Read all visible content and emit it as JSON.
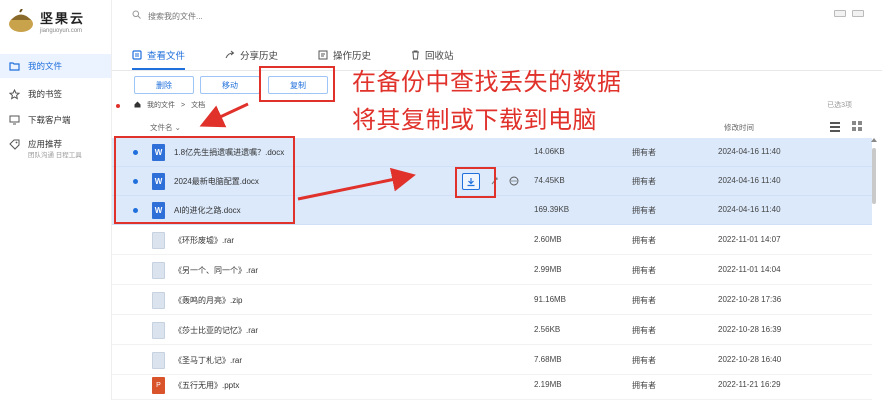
{
  "brand": {
    "name": "坚果云",
    "subtitle": "jianguoyun.com"
  },
  "sidebar": {
    "items": [
      {
        "label": "我的文件",
        "icon": "folder-icon",
        "active": true
      },
      {
        "label": "我的书签",
        "icon": "star-icon",
        "active": false
      },
      {
        "label": "下载客户端",
        "icon": "monitor-icon",
        "active": false
      },
      {
        "label": "应用推荐",
        "icon": "tag-icon",
        "active": false
      }
    ],
    "recommend_sub": "团队沟通 日程工具"
  },
  "search": {
    "placeholder": "搜索我的文件..."
  },
  "tabs": [
    {
      "label": "查看文件",
      "icon": "file-view-icon",
      "active": true
    },
    {
      "label": "分享历史",
      "icon": "share-icon",
      "active": false
    },
    {
      "label": "操作历史",
      "icon": "history-icon",
      "active": false
    },
    {
      "label": "回收站",
      "icon": "trash-icon",
      "active": false
    }
  ],
  "toolbar": {
    "delete_label": "删除",
    "move_label": "移动",
    "copy_label": "复制"
  },
  "breadcrumb": {
    "root": "我的文件",
    "sep": ">",
    "current": "文档"
  },
  "selected_info": "已选3项",
  "table": {
    "headers": {
      "name": "文件名",
      "size": "",
      "owner": "",
      "date": "修改时间"
    },
    "rows": [
      {
        "name": "1.8亿先生捐遗嘱进遗嘱？.docx",
        "size": "14.06KB",
        "owner": "拥有者",
        "date": "2024-04-16 11:40",
        "type": "word",
        "selected": true
      },
      {
        "name": "2024最新电脑配置.docx",
        "size": "74.45KB",
        "owner": "拥有者",
        "date": "2024-04-16 11:40",
        "type": "word",
        "selected": true
      },
      {
        "name": "AI的进化之路.docx",
        "size": "169.39KB",
        "owner": "拥有者",
        "date": "2024-04-16 11:40",
        "type": "word",
        "selected": true
      },
      {
        "name": "《环形废墟》.rar",
        "size": "2.60MB",
        "owner": "拥有者",
        "date": "2022-11-01 14:07",
        "type": "rar",
        "selected": false
      },
      {
        "name": "《另一个、同一个》.rar",
        "size": "2.99MB",
        "owner": "拥有者",
        "date": "2022-11-01 14:04",
        "type": "rar",
        "selected": false
      },
      {
        "name": "《轰鸣的月亮》.zip",
        "size": "91.16MB",
        "owner": "拥有者",
        "date": "2022-10-28 17:36",
        "type": "zip",
        "selected": false
      },
      {
        "name": "《莎士比亚的记忆》.rar",
        "size": "2.56KB",
        "owner": "拥有者",
        "date": "2022-10-28 16:39",
        "type": "rar",
        "selected": false
      },
      {
        "name": "《圣马丁札记》.rar",
        "size": "7.68MB",
        "owner": "拥有者",
        "date": "2022-10-28 16:40",
        "type": "rar",
        "selected": false
      },
      {
        "name": "《五行无用》.pptx",
        "size": "2.19MB",
        "owner": "拥有者",
        "date": "2022-11-21 16:29",
        "type": "ppt",
        "selected": false
      }
    ]
  },
  "annotation": {
    "line1": "在备份中查找丢失的数据",
    "line2": "将其复制或下载到电脑",
    "color": "#e0312b"
  },
  "colors": {
    "accent": "#1f6fdc",
    "selected_row": "#dbe9fb"
  }
}
